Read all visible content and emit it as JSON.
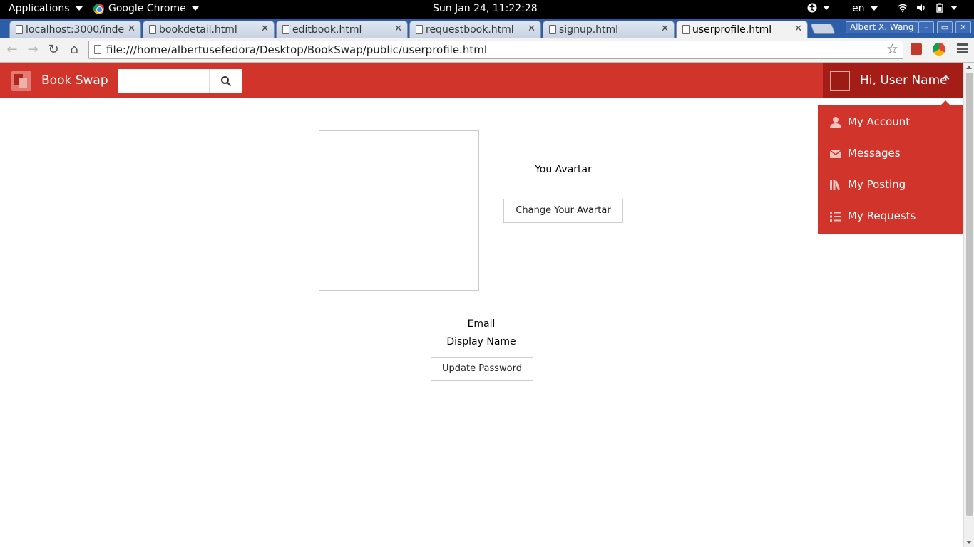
{
  "os_topbar": {
    "applications": "Applications",
    "app_name": "Google Chrome",
    "clock": "Sun Jan 24, 11:22:28",
    "language": "en"
  },
  "browser": {
    "tabs": [
      {
        "label": "localhost:3000/inde",
        "active": false
      },
      {
        "label": "bookdetail.html",
        "active": false
      },
      {
        "label": "editbook.html",
        "active": false
      },
      {
        "label": "requestbook.html",
        "active": false
      },
      {
        "label": "signup.html",
        "active": false
      },
      {
        "label": "userprofile.html",
        "active": true
      }
    ],
    "profile_name": "Albert X. Wang",
    "url": "file:///home/albertusefedora/Desktop/BookSwap/public/userprofile.html"
  },
  "navbar": {
    "brand": "Book Swap",
    "search_placeholder": "",
    "greeting": "Hi, User Name"
  },
  "dropdown": {
    "items": [
      {
        "label": "My Account",
        "icon": "person-icon"
      },
      {
        "label": "Messages",
        "icon": "envelope-icon"
      },
      {
        "label": "My Posting",
        "icon": "books-icon"
      },
      {
        "label": "My Requests",
        "icon": "list-icon"
      }
    ]
  },
  "profile": {
    "avatar_label": "You Avartar",
    "change_avatar_button": "Change Your Avartar",
    "email_label": "Email",
    "display_name_label": "Display Name",
    "update_password_button": "Update Password"
  },
  "colors": {
    "brand_red": "#d1342b",
    "brand_dark_red": "#a51d17"
  }
}
